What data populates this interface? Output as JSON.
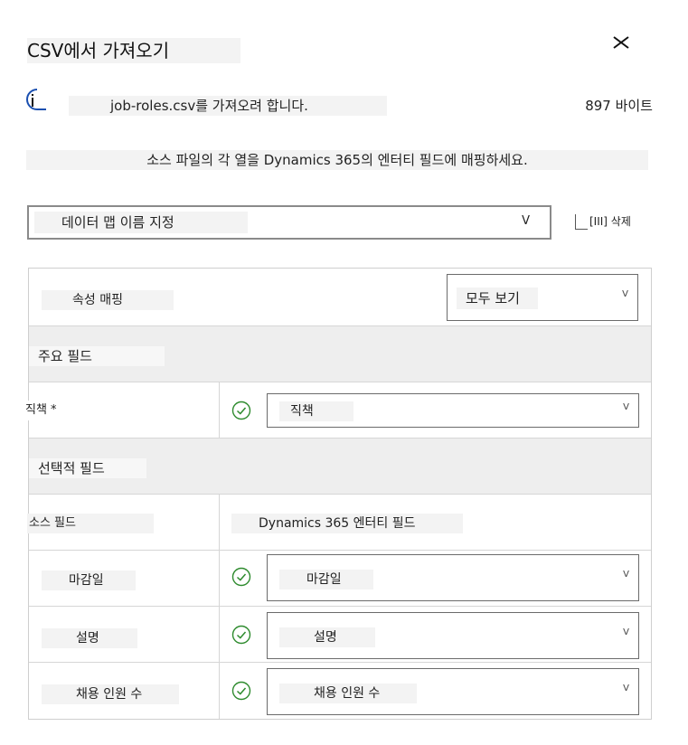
{
  "dialog": {
    "title": "CSV에서 가져오기",
    "file_message": "job-roles.csv를 가져오려 합니다.",
    "file_size": "897 바이트",
    "instruction": "소스 파일의 각 열을 Dynamics 365의 엔터티 필드에 매핑하세요."
  },
  "map_name": {
    "placeholder": "데이터 맵 이름 지정",
    "chevron": "V"
  },
  "delete_button": {
    "label": "[III] 삭제"
  },
  "mapping": {
    "header_label": "속성 매핑",
    "view_select": "모두 보기",
    "primary_section": "주요 필드",
    "primary_fields": [
      {
        "source": "직책 *",
        "target": "직책"
      }
    ],
    "optional_section": "선택적 필드",
    "column_headers": {
      "source": "소스 필드",
      "target": "Dynamics 365 엔터티 필드"
    },
    "optional_fields": [
      {
        "source": "마감일",
        "target": "마감일"
      },
      {
        "source": "설명",
        "target": "설명"
      },
      {
        "source": "채용 인원 수",
        "target": "채용 인원 수"
      }
    ],
    "chevron": "V"
  },
  "colors": {
    "check": "#2e8b2e",
    "info": "#1a4fb0",
    "section_bg": "#eeeeee"
  }
}
